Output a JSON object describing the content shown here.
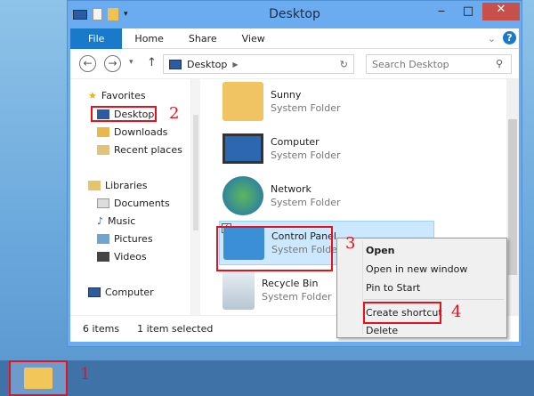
{
  "window": {
    "title": "Desktop",
    "minimize": "‒",
    "maximize": "□",
    "close": "✕"
  },
  "ribbon": {
    "tabs": [
      "File",
      "Home",
      "Share",
      "View"
    ],
    "help": "?"
  },
  "address": {
    "back": "←",
    "forward": "→",
    "up": "↑",
    "path": "Desktop",
    "search_placeholder": "Search Desktop"
  },
  "nav": {
    "favorites": "Favorites",
    "desktop": "Desktop",
    "downloads": "Downloads",
    "recent": "Recent places",
    "libraries": "Libraries",
    "documents": "Documents",
    "music": "Music",
    "pictures": "Pictures",
    "videos": "Videos",
    "computer": "Computer"
  },
  "items": [
    {
      "name": "Sunny",
      "type": "System Folder"
    },
    {
      "name": "Computer",
      "type": "System Folder"
    },
    {
      "name": "Network",
      "type": "System Folder"
    },
    {
      "name": "Control Panel",
      "type": "System Folder"
    },
    {
      "name": "Recycle Bin",
      "type": "System Folder"
    }
  ],
  "status": {
    "count": "6 items",
    "selected": "1 item selected"
  },
  "context_menu": [
    "Open",
    "Open in new window",
    "Pin to Start",
    "Create shortcut",
    "Delete"
  ],
  "steps": [
    "1",
    "2",
    "3",
    "4"
  ]
}
